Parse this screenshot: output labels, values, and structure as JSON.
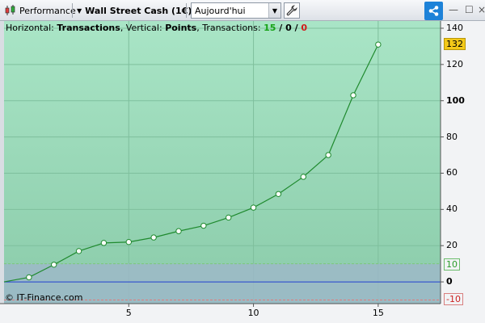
{
  "toolbar": {
    "app_label": "Performance",
    "instrument_label": "Wall Street Cash (1€)",
    "period_select": {
      "value": "Aujourd'hui"
    }
  },
  "header": {
    "horizontal_label": "Horizontal: ",
    "horizontal_value": "Transactions",
    "vertical_label": ", Vertical: ",
    "vertical_value": "Points",
    "transactions_label": ", Transactions: ",
    "transactions_win": "15",
    "slash1": " / ",
    "transactions_neutral": "0",
    "slash2": " / ",
    "transactions_loss": "0"
  },
  "copyright": "© IT-Finance.com",
  "badges": {
    "current": "132",
    "upper_band": "10",
    "lower_band": "-10"
  },
  "colors": {
    "line": "#1f8a2e",
    "zero_line": "#1f3fd1",
    "upper_band": "#7cc77c",
    "lower_band": "#e07a7a",
    "share": "#1d82d8"
  },
  "chart_data": {
    "type": "line",
    "x": [
      0,
      1,
      2,
      3,
      4,
      5,
      6,
      7,
      8,
      9,
      10,
      11,
      12,
      13,
      14,
      15
    ],
    "y": [
      0,
      2.5,
      9.5,
      17,
      21.5,
      22,
      24.5,
      28,
      31,
      35.5,
      41,
      48.5,
      58,
      70,
      103,
      131
    ],
    "xlabel": "",
    "ylabel": "",
    "xlim": [
      0,
      17.5
    ],
    "ylim": [
      -12,
      144
    ],
    "x_ticks": [
      "5",
      "10",
      "15"
    ],
    "x_tick_values": [
      5,
      10,
      15
    ],
    "y_ticks": [
      "140",
      "120",
      "100",
      "80",
      "60",
      "40",
      "20",
      "0"
    ],
    "y_tick_values": [
      140,
      120,
      100,
      80,
      60,
      40,
      20,
      0
    ],
    "bold_y_ticks": [
      "100",
      "0"
    ],
    "bands": {
      "upper": 10,
      "lower": -10
    },
    "grid": true,
    "legend": "none"
  }
}
